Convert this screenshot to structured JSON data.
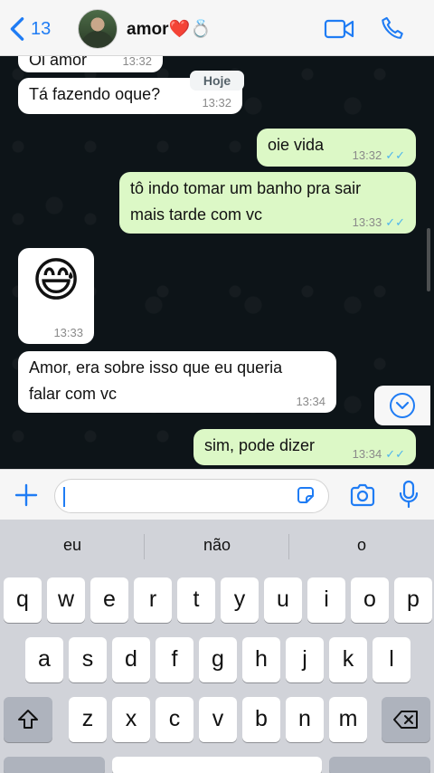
{
  "header": {
    "back_count": "13",
    "contact_name": "amor❤️💍"
  },
  "chat": {
    "date_chip": "Hoje",
    "messages": [
      {
        "dir": "in",
        "text": "Oi amor",
        "time": "13:32"
      },
      {
        "dir": "in",
        "text": "Tá fazendo oque?",
        "time": "13:32"
      },
      {
        "dir": "out",
        "text": "oie vida",
        "time": "13:32",
        "ticks": "✓✓"
      },
      {
        "dir": "out",
        "line1": "tô indo tomar um banho pra sair",
        "line2": "mais tarde com vc",
        "time": "13:33",
        "ticks": "✓✓"
      },
      {
        "dir": "in",
        "emoji": "😅",
        "time": "13:33"
      },
      {
        "dir": "in",
        "line1": "Amor, era sobre isso que eu queria",
        "line2": "falar com vc",
        "time": "13:34"
      },
      {
        "dir": "out",
        "text": "sim, pode dizer",
        "time": "13:34",
        "ticks": "✓✓"
      }
    ]
  },
  "input": {
    "value": "",
    "placeholder": ""
  },
  "keyboard": {
    "suggestions": [
      "eu",
      "não",
      "o"
    ],
    "row1": [
      "q",
      "w",
      "e",
      "r",
      "t",
      "y",
      "u",
      "i",
      "o",
      "p"
    ],
    "row2": [
      "a",
      "s",
      "d",
      "f",
      "g",
      "h",
      "j",
      "k",
      "l"
    ],
    "row3": [
      "z",
      "x",
      "c",
      "v",
      "b",
      "n",
      "m"
    ]
  },
  "colors": {
    "accent": "#1f7cf4",
    "outgoing_bubble": "#dcf8c6",
    "incoming_bubble": "#ffffff",
    "chat_background": "#0d1418",
    "read_ticks": "#4fb6ec"
  }
}
